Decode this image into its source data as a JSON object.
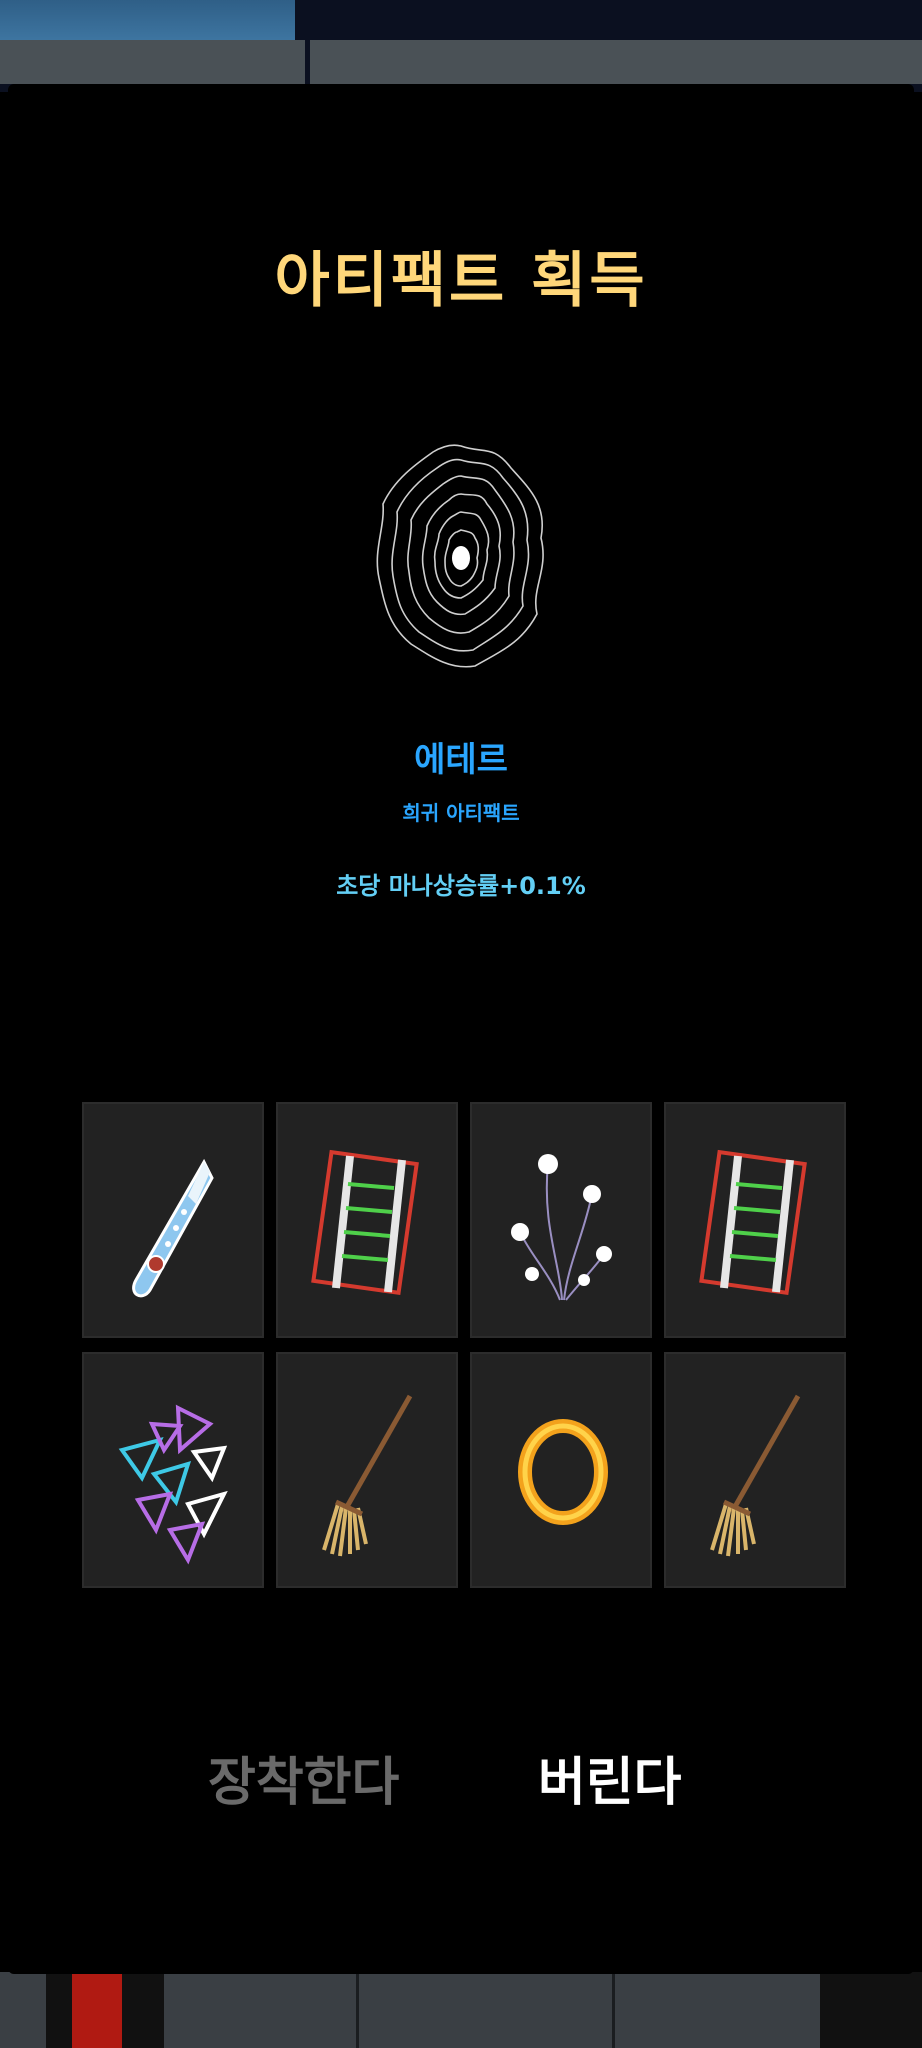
{
  "dialog": {
    "title": "아티팩트 획득",
    "item": {
      "name": "에테르",
      "rarity": "희귀 아티팩트",
      "effect": "초당 마나상승률+0.1%",
      "icon": "ether-swirl-icon"
    }
  },
  "inventory": {
    "slots": [
      {
        "icon": "dagger-icon"
      },
      {
        "icon": "thorn-rails-icon"
      },
      {
        "icon": "white-flower-icon"
      },
      {
        "icon": "thorn-rails-icon"
      },
      {
        "icon": "triangles-icon"
      },
      {
        "icon": "broom-icon"
      },
      {
        "icon": "golden-ring-icon"
      },
      {
        "icon": "broom-icon"
      }
    ]
  },
  "actions": {
    "equip_label": "장착한다",
    "discard_label": "버린다"
  },
  "colors": {
    "title": "#ffd77a",
    "item_name": "#2aa6ff",
    "effect": "#63cff5",
    "equip_disabled": "#6a6a6a",
    "discard": "#ffffff",
    "slot_bg": "#222222"
  }
}
